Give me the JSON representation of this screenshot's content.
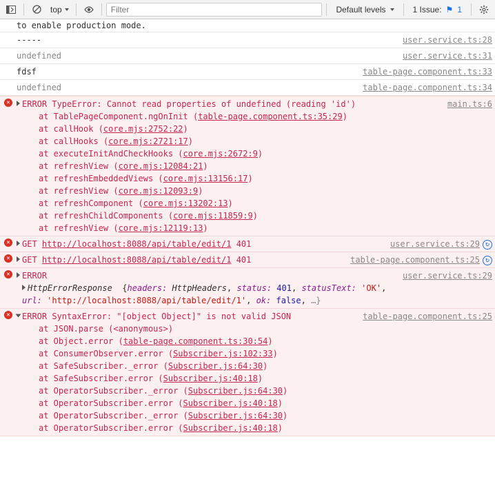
{
  "toolbar": {
    "scope": "top",
    "filter_placeholder": "Filter",
    "levels": "Default levels",
    "issues_label": "1 Issue:",
    "issues_count": "1"
  },
  "pretext": "to enable production mode.",
  "logs": [
    {
      "msg": "-----",
      "src": "user.service.ts:28"
    },
    {
      "msg": "undefined",
      "src": "user.service.ts:31",
      "undef": true
    },
    {
      "msg": "fdsf",
      "src": "table-page.component.ts:33"
    },
    {
      "msg": "undefined",
      "src": "table-page.component.ts:34",
      "undef": true
    }
  ],
  "error1": {
    "prefix": "ERROR",
    "head": "TypeError: Cannot read properties of undefined (reading 'id')",
    "src": "main.ts:6",
    "stack": [
      {
        "fn": "TablePageComponent.ngOnInit",
        "loc": "table-page.component.ts:35:29"
      },
      {
        "fn": "callHook",
        "loc": "core.mjs:2752:22"
      },
      {
        "fn": "callHooks",
        "loc": "core.mjs:2721:17"
      },
      {
        "fn": "executeInitAndCheckHooks",
        "loc": "core.mjs:2672:9"
      },
      {
        "fn": "refreshView",
        "loc": "core.mjs:12084:21"
      },
      {
        "fn": "refreshEmbeddedViews",
        "loc": "core.mjs:13156:17"
      },
      {
        "fn": "refreshView",
        "loc": "core.mjs:12093:9"
      },
      {
        "fn": "refreshComponent",
        "loc": "core.mjs:13202:13"
      },
      {
        "fn": "refreshChildComponents",
        "loc": "core.mjs:11859:9"
      },
      {
        "fn": "refreshView",
        "loc": "core.mjs:12119:13"
      }
    ]
  },
  "http1": {
    "method": "GET",
    "url": "http://localhost:8088/api/table/edit/1",
    "status": "401",
    "src": "user.service.ts:29"
  },
  "http2": {
    "method": "GET",
    "url": "http://localhost:8088/api/table/edit/1",
    "status": "401",
    "src": "table-page.component.ts:25"
  },
  "error2": {
    "prefix": "ERROR",
    "src": "user.service.ts:29",
    "obj_name": "HttpErrorResponse",
    "headers_key": "headers:",
    "headers_val": "HttpHeaders",
    "status_key": "status:",
    "status_val": "401",
    "stext_key": "statusText:",
    "stext_val": "'OK'",
    "url_key": "url:",
    "url_val": "'http://localhost:8088/api/table/edit/1'",
    "ok_key": "ok:",
    "ok_val": "false"
  },
  "error3": {
    "prefix": "ERROR",
    "head": "SyntaxError: \"[object Object]\" is not valid JSON",
    "src": "table-page.component.ts:25",
    "stack": [
      {
        "fn": "JSON.parse",
        "loc": "<anonymous>",
        "nolink": true
      },
      {
        "fn": "Object.error",
        "loc": "table-page.component.ts:30:54"
      },
      {
        "fn": "ConsumerObserver.error",
        "loc": "Subscriber.js:102:33"
      },
      {
        "fn": "SafeSubscriber._error",
        "loc": "Subscriber.js:64:30"
      },
      {
        "fn": "SafeSubscriber.error",
        "loc": "Subscriber.js:40:18"
      },
      {
        "fn": "OperatorSubscriber._error",
        "loc": "Subscriber.js:64:30"
      },
      {
        "fn": "OperatorSubscriber.error",
        "loc": "Subscriber.js:40:18"
      },
      {
        "fn": "OperatorSubscriber._error",
        "loc": "Subscriber.js:64:30"
      },
      {
        "fn": "OperatorSubscriber.error",
        "loc": "Subscriber.js:40:18"
      }
    ]
  }
}
